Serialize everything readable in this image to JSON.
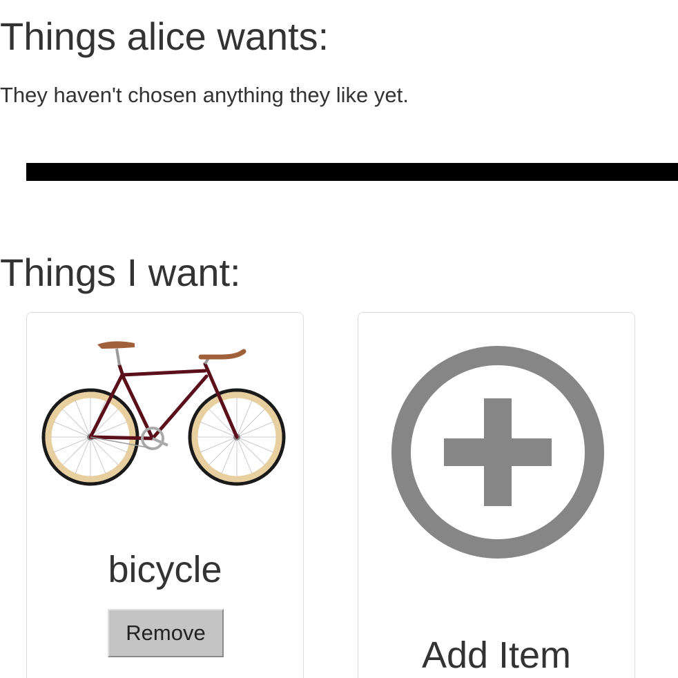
{
  "friend_section": {
    "title": "Things alice wants:",
    "empty_message": "They haven't chosen anything they like yet."
  },
  "my_section": {
    "title": "Things I want:",
    "items": [
      {
        "name": "bicycle",
        "image_icon": "bicycle-photo",
        "remove_label": "Remove"
      }
    ],
    "add_card": {
      "icon": "plus-circle-icon",
      "label": "Add Item"
    }
  },
  "colors": {
    "text": "#333333",
    "divider": "#000000",
    "add_icon": "#868686",
    "button_bg": "#c4c4c4",
    "card_border": "#dcdcdc"
  }
}
